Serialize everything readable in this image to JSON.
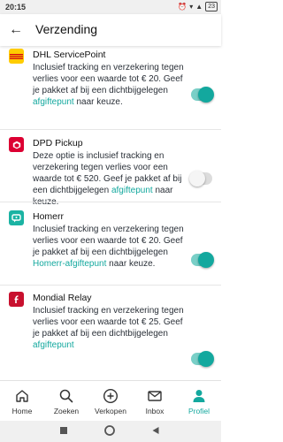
{
  "status_bar": {
    "time": "20:15",
    "battery": "23"
  },
  "header": {
    "title": "Verzending"
  },
  "colors": {
    "accent": "#13a89e",
    "dhl": "#ffcc00",
    "dpd": "#dc0032",
    "homerr": "#1bb3a3",
    "mondial": "#c8102e"
  },
  "options": [
    {
      "name": "DHL ServicePoint",
      "desc_before": "Inclusief tracking en verzekering tegen verlies voor een waarde tot € 20. Geef je pakket af bij een dichtbijgelegen ",
      "link": "afgiftepunt",
      "desc_after": " naar keuze.",
      "enabled": true,
      "icon": "dhl-logo-icon"
    },
    {
      "name": "DPD Pickup",
      "desc_before": "Deze optie is inclusief tracking en verzekering tegen verlies voor een waarde tot € 520. Geef je pakket af bij een dichtbijgelegen ",
      "link": "afgiftepunt",
      "desc_after": " naar keuze.",
      "enabled": false,
      "icon": "dpd-logo-icon"
    },
    {
      "name": "Homerr",
      "desc_before": "Inclusief tracking en verzekering tegen verlies voor een waarde tot € 20. Geef je pakket af bij een dichtbijgelegen ",
      "link": "Homerr-afgiftepunt",
      "desc_after": " naar keuze.",
      "enabled": true,
      "icon": "homerr-logo-icon"
    },
    {
      "name": "Mondial Relay",
      "desc_before": "Inclusief tracking en verzekering tegen verlies voor een waarde tot € 25. Geef je pakket af bij een dichtbijgelegen ",
      "link": "afgiftepunt",
      "desc_after": "",
      "enabled": true,
      "icon": "mondial-relay-logo-icon"
    }
  ],
  "nav": [
    {
      "label": "Home",
      "icon": "home-icon",
      "active": false
    },
    {
      "label": "Zoeken",
      "icon": "search-icon",
      "active": false
    },
    {
      "label": "Verkopen",
      "icon": "plus-circle-icon",
      "active": false
    },
    {
      "label": "Inbox",
      "icon": "mail-icon",
      "active": false
    },
    {
      "label": "Profiel",
      "icon": "profile-icon",
      "active": true
    }
  ]
}
